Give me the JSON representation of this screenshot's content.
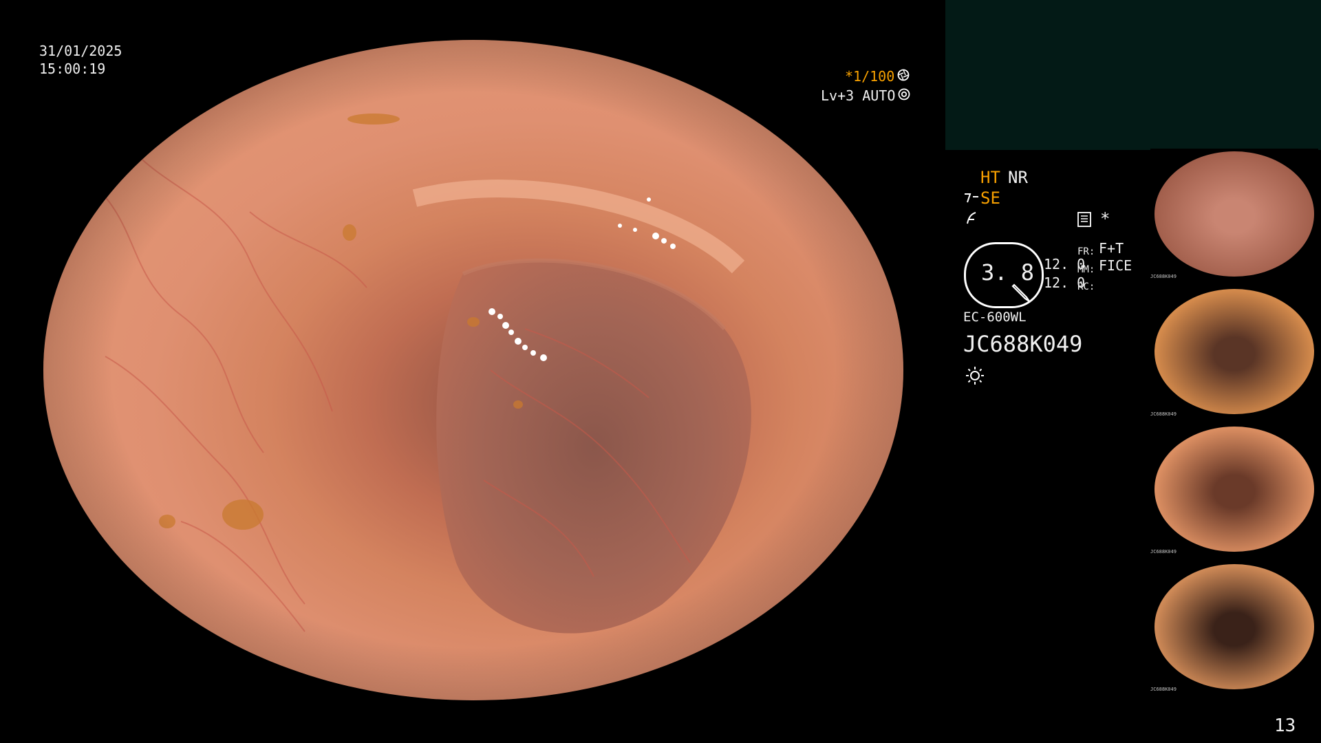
{
  "overlay": {
    "date": "31/01/2025",
    "time": "15:00:19",
    "shutter": "*1/100",
    "iris_mode": "Lv+3 AUTO",
    "page_number": "13"
  },
  "status": {
    "ht": "HT",
    "nr": "NR",
    "se": "SE",
    "fr_label": "FR:",
    "fr_value": "F+T",
    "mm_label": "MM:",
    "mm_value": "FICE",
    "rc_label": "RC:",
    "gauge_value": "3. 8",
    "value_1": "12. 0",
    "value_2": "12. 0",
    "asterisk": "*"
  },
  "scope": {
    "model": "EC-600WL",
    "serial": "JC688K049"
  },
  "thumbnails": [
    {
      "caption": "JC688K049",
      "color_center": "#c98572",
      "color_edge": "#a25f4c"
    },
    {
      "caption": "JC688K049",
      "color_center": "#5a3526",
      "color_edge": "#d58b4c"
    },
    {
      "caption": "JC688K049",
      "color_center": "#6a3a29",
      "color_edge": "#dc8f62"
    },
    {
      "caption": "JC688K049",
      "color_center": "#3a2219",
      "color_edge": "#cf8a57"
    }
  ],
  "colors": {
    "accent": "#f7a000",
    "top_blank": "#031a16",
    "mucosa": "#df9071"
  }
}
